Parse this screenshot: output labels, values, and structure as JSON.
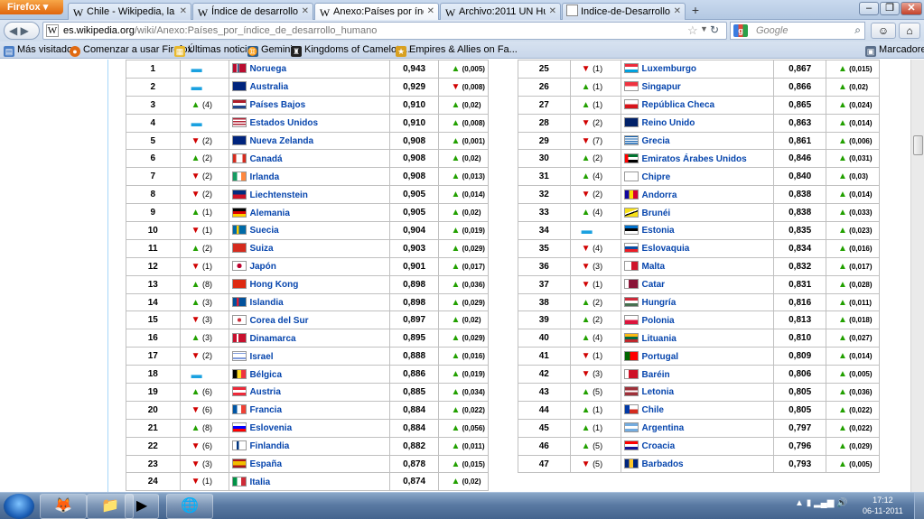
{
  "browser": {
    "menu_label": "Firefox ▾",
    "tabs": [
      {
        "title": "Chile - Wikipedia, la enci...",
        "icon": "W",
        "active": false
      },
      {
        "title": "Índice de desarrollo hum...",
        "icon": "W",
        "active": false
      },
      {
        "title": "Anexo:Países por índice ...",
        "icon": "W",
        "active": true
      },
      {
        "title": "Archivo:2011 UN Human...",
        "icon": "W",
        "active": false
      },
      {
        "title": "Indice-de-Desarrollo-Hu...",
        "icon": "page",
        "active": false
      }
    ],
    "url_domain": "es.wikipedia.org",
    "url_path": "/wiki/Anexo:Países_por_índice_de_desarrollo_humano",
    "search_placeholder": "Google",
    "bookmarks": [
      "Más visitados",
      "Comenzar a usar Firefox",
      "Últimas noticias",
      "Gemini",
      "Kingdoms of Camelot ...",
      "Empires & Allies on Fa..."
    ],
    "bookmarks_right": "Marcadores"
  },
  "taskbar": {
    "time": "17:12",
    "date": "06-11-2011"
  },
  "ranking_left": [
    {
      "rank": "1",
      "change": "",
      "dir": "eq",
      "country": "Noruega",
      "flag": "no",
      "hdi": "0,943",
      "delta": "(0,005)",
      "ddir": "up"
    },
    {
      "rank": "2",
      "change": "",
      "dir": "eq",
      "country": "Australia",
      "flag": "au",
      "hdi": "0,929",
      "delta": "(0,008)",
      "ddir": "dn"
    },
    {
      "rank": "3",
      "change": "(4)",
      "dir": "up",
      "country": "Países Bajos",
      "flag": "nl",
      "hdi": "0,910",
      "delta": "(0,02)",
      "ddir": "up"
    },
    {
      "rank": "4",
      "change": "",
      "dir": "eq",
      "country": "Estados Unidos",
      "flag": "us",
      "hdi": "0,910",
      "delta": "(0,008)",
      "ddir": "up"
    },
    {
      "rank": "5",
      "change": "(2)",
      "dir": "dn",
      "country": "Nueva Zelanda",
      "flag": "nz",
      "hdi": "0,908",
      "delta": "(0,001)",
      "ddir": "up"
    },
    {
      "rank": "6",
      "change": "(2)",
      "dir": "up",
      "country": "Canadá",
      "flag": "ca",
      "hdi": "0,908",
      "delta": "(0,02)",
      "ddir": "up"
    },
    {
      "rank": "7",
      "change": "(2)",
      "dir": "dn",
      "country": "Irlanda",
      "flag": "ie",
      "hdi": "0,908",
      "delta": "(0,013)",
      "ddir": "up"
    },
    {
      "rank": "8",
      "change": "(2)",
      "dir": "dn",
      "country": "Liechtenstein",
      "flag": "li",
      "hdi": "0,905",
      "delta": "(0,014)",
      "ddir": "up"
    },
    {
      "rank": "9",
      "change": "(1)",
      "dir": "up",
      "country": "Alemania",
      "flag": "de",
      "hdi": "0,905",
      "delta": "(0,02)",
      "ddir": "up"
    },
    {
      "rank": "10",
      "change": "(1)",
      "dir": "dn",
      "country": "Suecia",
      "flag": "se",
      "hdi": "0,904",
      "delta": "(0,019)",
      "ddir": "up"
    },
    {
      "rank": "11",
      "change": "(2)",
      "dir": "up",
      "country": "Suiza",
      "flag": "ch",
      "hdi": "0,903",
      "delta": "(0,029)",
      "ddir": "up"
    },
    {
      "rank": "12",
      "change": "(1)",
      "dir": "dn",
      "country": "Japón",
      "flag": "jp",
      "hdi": "0,901",
      "delta": "(0,017)",
      "ddir": "up"
    },
    {
      "rank": "13",
      "change": "(8)",
      "dir": "up",
      "country": "Hong Kong",
      "flag": "hk",
      "hdi": "0,898",
      "delta": "(0,036)",
      "ddir": "up"
    },
    {
      "rank": "14",
      "change": "(3)",
      "dir": "up",
      "country": "Islandia",
      "flag": "is",
      "hdi": "0,898",
      "delta": "(0,029)",
      "ddir": "up"
    },
    {
      "rank": "15",
      "change": "(3)",
      "dir": "dn",
      "country": "Corea del Sur",
      "flag": "kr",
      "hdi": "0,897",
      "delta": "(0,02)",
      "ddir": "up"
    },
    {
      "rank": "16",
      "change": "(3)",
      "dir": "up",
      "country": "Dinamarca",
      "flag": "dk",
      "hdi": "0,895",
      "delta": "(0,029)",
      "ddir": "up"
    },
    {
      "rank": "17",
      "change": "(2)",
      "dir": "dn",
      "country": "Israel",
      "flag": "il",
      "hdi": "0,888",
      "delta": "(0,016)",
      "ddir": "up"
    },
    {
      "rank": "18",
      "change": "",
      "dir": "eq",
      "country": "Bélgica",
      "flag": "be",
      "hdi": "0,886",
      "delta": "(0,019)",
      "ddir": "up"
    },
    {
      "rank": "19",
      "change": "(6)",
      "dir": "up",
      "country": "Austria",
      "flag": "at",
      "hdi": "0,885",
      "delta": "(0,034)",
      "ddir": "up"
    },
    {
      "rank": "20",
      "change": "(6)",
      "dir": "dn",
      "country": "Francia",
      "flag": "fr",
      "hdi": "0,884",
      "delta": "(0,022)",
      "ddir": "up"
    },
    {
      "rank": "21",
      "change": "(8)",
      "dir": "up",
      "country": "Eslovenia",
      "flag": "si",
      "hdi": "0,884",
      "delta": "(0,056)",
      "ddir": "up"
    },
    {
      "rank": "22",
      "change": "(6)",
      "dir": "dn",
      "country": "Finlandia",
      "flag": "fi",
      "hdi": "0,882",
      "delta": "(0,011)",
      "ddir": "up"
    },
    {
      "rank": "23",
      "change": "(3)",
      "dir": "dn",
      "country": "España",
      "flag": "es",
      "hdi": "0,878",
      "delta": "(0,015)",
      "ddir": "up"
    },
    {
      "rank": "24",
      "change": "(1)",
      "dir": "dn",
      "country": "Italia",
      "flag": "it",
      "hdi": "0,874",
      "delta": "(0,02)",
      "ddir": "up"
    }
  ],
  "ranking_right": [
    {
      "rank": "25",
      "change": "(1)",
      "dir": "dn",
      "country": "Luxemburgo",
      "flag": "lu",
      "hdi": "0,867",
      "delta": "(0,015)",
      "ddir": "up"
    },
    {
      "rank": "26",
      "change": "(1)",
      "dir": "up",
      "country": "Singapur",
      "flag": "sg",
      "hdi": "0,866",
      "delta": "(0,02)",
      "ddir": "up"
    },
    {
      "rank": "27",
      "change": "(1)",
      "dir": "up",
      "country": "República Checa",
      "flag": "cz",
      "hdi": "0,865",
      "delta": "(0,024)",
      "ddir": "up"
    },
    {
      "rank": "28",
      "change": "(2)",
      "dir": "dn",
      "country": "Reino Unido",
      "flag": "gb",
      "hdi": "0,863",
      "delta": "(0,014)",
      "ddir": "up"
    },
    {
      "rank": "29",
      "change": "(7)",
      "dir": "dn",
      "country": "Grecia",
      "flag": "gr",
      "hdi": "0,861",
      "delta": "(0,006)",
      "ddir": "up"
    },
    {
      "rank": "30",
      "change": "(2)",
      "dir": "up",
      "country": "Emiratos Árabes Unidos",
      "flag": "ae",
      "hdi": "0,846",
      "delta": "(0,031)",
      "ddir": "up"
    },
    {
      "rank": "31",
      "change": "(4)",
      "dir": "up",
      "country": "Chipre",
      "flag": "cy",
      "hdi": "0,840",
      "delta": "(0,03)",
      "ddir": "up"
    },
    {
      "rank": "32",
      "change": "(2)",
      "dir": "dn",
      "country": "Andorra",
      "flag": "ad",
      "hdi": "0,838",
      "delta": "(0,014)",
      "ddir": "up"
    },
    {
      "rank": "33",
      "change": "(4)",
      "dir": "up",
      "country": "Brunéi",
      "flag": "bn",
      "hdi": "0,838",
      "delta": "(0,033)",
      "ddir": "up"
    },
    {
      "rank": "34",
      "change": "",
      "dir": "eq",
      "country": "Estonia",
      "flag": "ee",
      "hdi": "0,835",
      "delta": "(0,023)",
      "ddir": "up"
    },
    {
      "rank": "35",
      "change": "(4)",
      "dir": "dn",
      "country": "Eslovaquia",
      "flag": "sk",
      "hdi": "0,834",
      "delta": "(0,016)",
      "ddir": "up"
    },
    {
      "rank": "36",
      "change": "(3)",
      "dir": "dn",
      "country": "Malta",
      "flag": "mt",
      "hdi": "0,832",
      "delta": "(0,017)",
      "ddir": "up"
    },
    {
      "rank": "37",
      "change": "(1)",
      "dir": "dn",
      "country": "Catar",
      "flag": "qa",
      "hdi": "0,831",
      "delta": "(0,028)",
      "ddir": "up"
    },
    {
      "rank": "38",
      "change": "(2)",
      "dir": "up",
      "country": "Hungría",
      "flag": "hu",
      "hdi": "0,816",
      "delta": "(0,011)",
      "ddir": "up"
    },
    {
      "rank": "39",
      "change": "(2)",
      "dir": "up",
      "country": "Polonia",
      "flag": "pl",
      "hdi": "0,813",
      "delta": "(0,018)",
      "ddir": "up"
    },
    {
      "rank": "40",
      "change": "(4)",
      "dir": "up",
      "country": "Lituania",
      "flag": "lt",
      "hdi": "0,810",
      "delta": "(0,027)",
      "ddir": "up"
    },
    {
      "rank": "41",
      "change": "(1)",
      "dir": "dn",
      "country": "Portugal",
      "flag": "pt",
      "hdi": "0,809",
      "delta": "(0,014)",
      "ddir": "up"
    },
    {
      "rank": "42",
      "change": "(3)",
      "dir": "dn",
      "country": "Baréin",
      "flag": "bh",
      "hdi": "0,806",
      "delta": "(0,005)",
      "ddir": "up"
    },
    {
      "rank": "43",
      "change": "(5)",
      "dir": "up",
      "country": "Letonia",
      "flag": "lv",
      "hdi": "0,805",
      "delta": "(0,036)",
      "ddir": "up"
    },
    {
      "rank": "44",
      "change": "(1)",
      "dir": "up",
      "country": "Chile",
      "flag": "cl",
      "hdi": "0,805",
      "delta": "(0,022)",
      "ddir": "up"
    },
    {
      "rank": "45",
      "change": "(1)",
      "dir": "up",
      "country": "Argentina",
      "flag": "ar",
      "hdi": "0,797",
      "delta": "(0,022)",
      "ddir": "up"
    },
    {
      "rank": "46",
      "change": "(5)",
      "dir": "up",
      "country": "Croacia",
      "flag": "hr",
      "hdi": "0,796",
      "delta": "(0,029)",
      "ddir": "up"
    },
    {
      "rank": "47",
      "change": "(5)",
      "dir": "dn",
      "country": "Barbados",
      "flag": "bb",
      "hdi": "0,793",
      "delta": "(0,005)",
      "ddir": "up"
    }
  ]
}
